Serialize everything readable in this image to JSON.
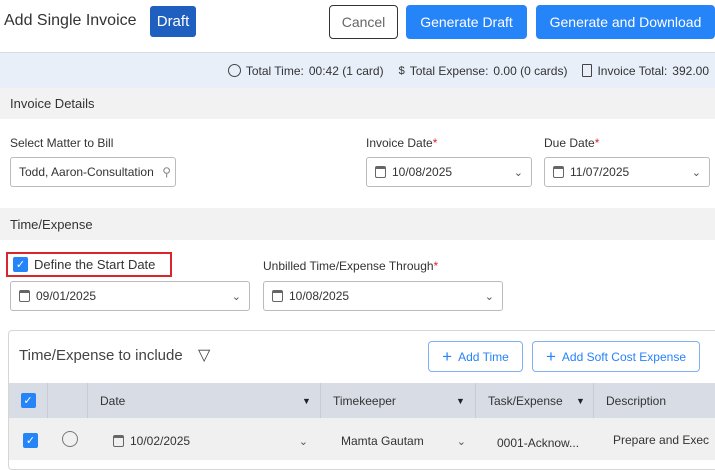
{
  "header": {
    "title": "Add Single Invoice",
    "status": "Draft",
    "cancel": "Cancel",
    "generate_draft": "Generate Draft",
    "generate_download": "Generate and Download"
  },
  "summary": {
    "time_label": "Total Time:",
    "time_value": "00:42 (1 card)",
    "expense_label": "Total Expense:",
    "expense_value": "0.00 (0 cards)",
    "total_label": "Invoice Total:",
    "total_value": "392.00"
  },
  "invoice_details": {
    "title": "Invoice Details",
    "matter_label": "Select Matter to Bill",
    "matter_value": "Todd, Aaron-Consultation",
    "invoice_date_label": "Invoice Date",
    "invoice_date": "10/08/2025",
    "due_date_label": "Due Date",
    "due_date": "11/07/2025"
  },
  "time_expense": {
    "title": "Time/Expense",
    "define_start": "Define the Start Date",
    "start_date": "09/01/2025",
    "through_label": "Unbilled Time/Expense Through",
    "through_date": "10/08/2025"
  },
  "include": {
    "title": "Time/Expense to include",
    "add_time": "Add Time",
    "add_soft_cost": "Add Soft Cost Expense",
    "columns": [
      "Date",
      "Timekeeper",
      "Task/Expense",
      "Description"
    ],
    "rows": [
      {
        "date": "10/02/2025",
        "timekeeper": "Mamta Gautam",
        "task": "0001-Acknow...",
        "description": "Prepare and Exec"
      }
    ]
  },
  "colors": {
    "primary": "#2584f7",
    "draft": "#1f5fbf",
    "highlight": "#d9262c"
  }
}
